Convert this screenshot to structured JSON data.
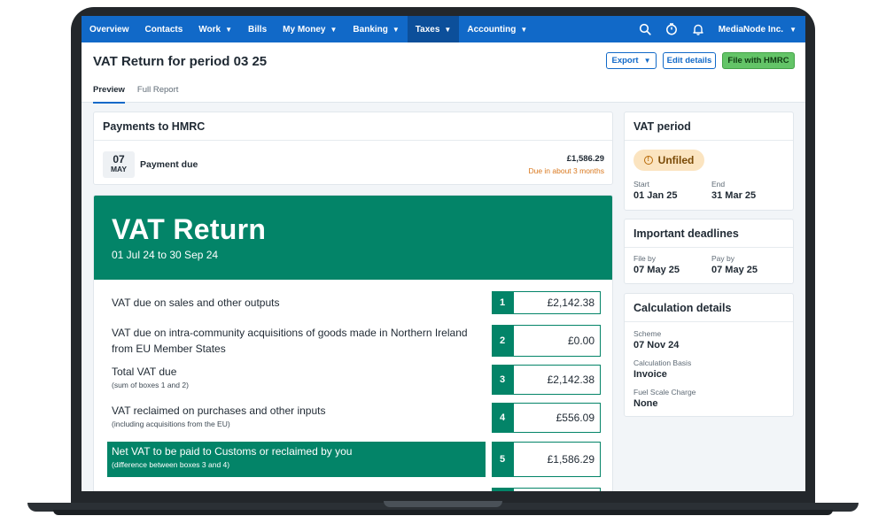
{
  "nav": {
    "items": [
      {
        "label": "Overview",
        "chevron": false,
        "active": false
      },
      {
        "label": "Contacts",
        "chevron": false,
        "active": false
      },
      {
        "label": "Work",
        "chevron": true,
        "active": false
      },
      {
        "label": "Bills",
        "chevron": false,
        "active": false
      },
      {
        "label": "My Money",
        "chevron": true,
        "active": false
      },
      {
        "label": "Banking",
        "chevron": true,
        "active": false
      },
      {
        "label": "Taxes",
        "chevron": true,
        "active": true
      },
      {
        "label": "Accounting",
        "chevron": true,
        "active": false
      }
    ],
    "icons": [
      "search-icon",
      "timer-icon",
      "bell-icon"
    ],
    "org_name": "MediaNode Inc."
  },
  "header": {
    "title": "VAT Return for period 03 25",
    "export_label": "Export",
    "edit_label": "Edit details",
    "file_label": "File with HMRC",
    "tabs": [
      "Preview",
      "Full Report"
    ]
  },
  "payments": {
    "title": "Payments to HMRC",
    "day": "07",
    "month": "MAY",
    "label": "Payment due",
    "amount": "£1,586.29",
    "due_text": "Due in about 3 months"
  },
  "vat_return": {
    "title": "VAT Return",
    "period": "01 Jul 24 to 30 Sep 24",
    "boxes": [
      {
        "text": "VAT due on sales and other outputs",
        "note": "",
        "number": "1",
        "value": "£2,142.38"
      },
      {
        "text": "VAT due on intra-community acquisitions of goods made in Northern Ireland from EU Member States",
        "note": "",
        "number": "2",
        "value": "£0.00"
      },
      {
        "text": "Total VAT due",
        "note": "(sum of boxes 1 and 2)",
        "number": "3",
        "value": "£2,142.38"
      },
      {
        "text": "VAT reclaimed on purchases and other inputs",
        "note": "(including acquisitions from the EU)",
        "number": "4",
        "value": "£556.09"
      },
      {
        "text": "Net VAT to be paid to Customs or reclaimed by you",
        "note": "(difference between boxes 3 and 4)",
        "number": "5",
        "value": "£1,586.29"
      }
    ]
  },
  "vat_period": {
    "title": "VAT period",
    "status": "Unfiled",
    "start_label": "Start",
    "start_value": "01 Jan 25",
    "end_label": "End",
    "end_value": "31 Mar 25"
  },
  "deadlines": {
    "title": "Important deadlines",
    "file_label": "File by",
    "file_value": "07 May 25",
    "pay_label": "Pay by",
    "pay_value": "07 May 25"
  },
  "calculation": {
    "title": "Calculation details",
    "scheme_label": "Scheme",
    "scheme_value": "07 Nov 24",
    "basis_label": "Calculation Basis",
    "basis_value": "Invoice",
    "fuel_label": "Fuel Scale Charge",
    "fuel_value": "None"
  },
  "colors": {
    "nav": "#1169c8",
    "accent_green": "#038468",
    "file_button": "#63c467",
    "warning_badge": "#fbe4c0",
    "due_text": "#d9771c"
  }
}
